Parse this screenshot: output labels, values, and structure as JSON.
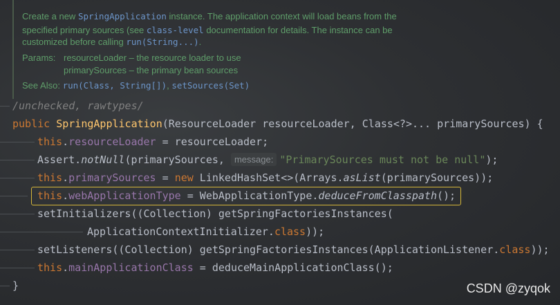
{
  "doc": {
    "line1a": "Create a new ",
    "line1b": "SpringApplication",
    "line1c": " instance. The application context will load beans from the",
    "line2a": "specified primary sources (see ",
    "line2b": "class-level",
    "line2c": " documentation for details. The instance can be",
    "line3a": "customized before calling ",
    "line3b": "run(String...)",
    "line3c": ".",
    "params_label": "Params:",
    "param1": "resourceLoader – the resource loader to use",
    "param2": "primarySources – the primary bean sources",
    "see_also_label": "See Also:",
    "see_also_1": "run(Class, String[])",
    "see_also_sep": ", ",
    "see_also_2": "setSources(Set)"
  },
  "code": {
    "annotation": "/unchecked, rawtypes/",
    "l1": {
      "kw": "public ",
      "name": "SpringApplication",
      "rest": "(ResourceLoader resourceLoader, Class<?>... primarySources) {"
    },
    "l2": {
      "this": "this",
      "dot": ".",
      "field": "resourceLoader",
      "rest": " = resourceLoader;"
    },
    "l3": {
      "pre": "Assert.",
      "method": "notNull",
      "args": "(primarySources, ",
      "hint": "message:",
      "str": "\"PrimarySources must not be null\"",
      "end": ");"
    },
    "l4": {
      "this": "this",
      "dot": ".",
      "field": "primarySources",
      "eq": " = ",
      "kw": "new",
      "mid": " LinkedHashSet<>(Arrays.",
      "method": "asList",
      "end": "(primarySources));"
    },
    "l5": {
      "this": "this",
      "dot": ".",
      "field": "webApplicationType",
      "eq": " = WebApplicationType.",
      "method": "deduceFromClasspath",
      "end": "();"
    },
    "l6": {
      "text": "setInitializers((Collection) getSpringFactoriesInstances("
    },
    "l7": {
      "pre": "ApplicationContextInitializer.",
      "kw": "class",
      "end": "));"
    },
    "l8": {
      "pre": "setListeners((Collection) getSpringFactoriesInstances(ApplicationListener.",
      "kw": "class",
      "end": "));"
    },
    "l9": {
      "this": "this",
      "dot": ".",
      "field": "mainApplicationClass",
      "end": " = deduceMainApplicationClass();"
    },
    "close": "}"
  },
  "watermark": "CSDN @zyqok"
}
